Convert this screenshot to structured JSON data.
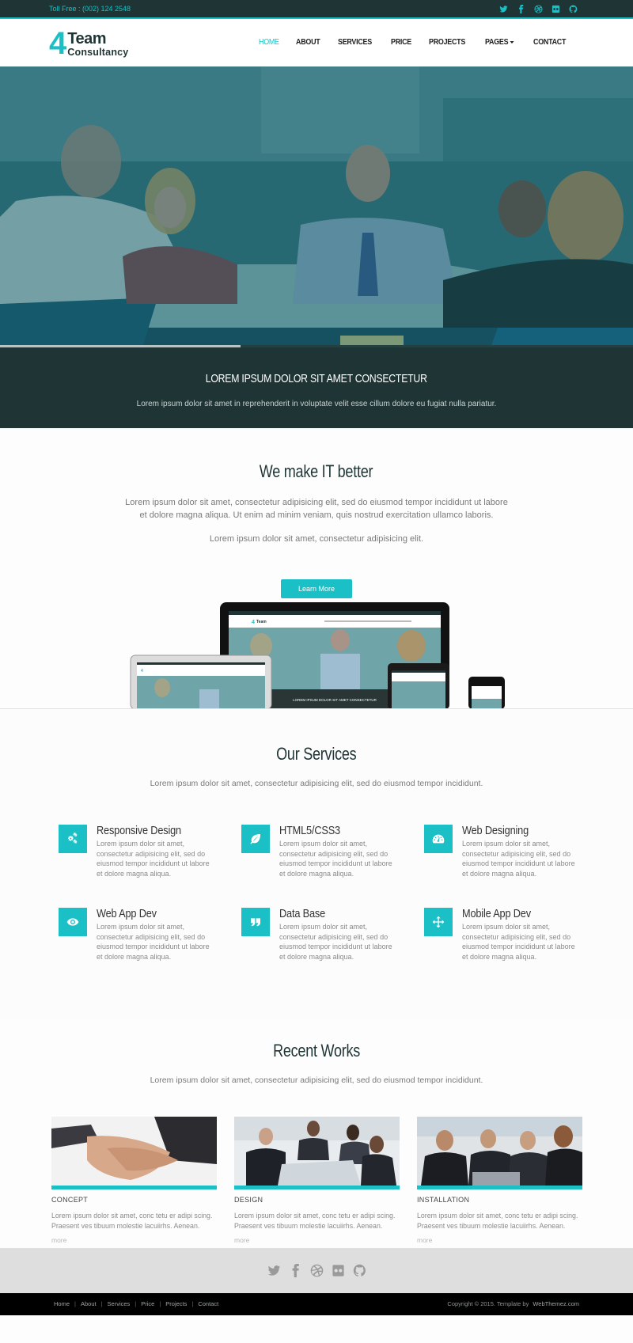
{
  "topbar": {
    "phone": "Toll Free : (002) 124 2548",
    "social": [
      "twitter-icon",
      "facebook-icon",
      "dribbble-icon",
      "flickr-icon",
      "github-icon"
    ]
  },
  "header": {
    "logo": {
      "digit": "4",
      "line1": "Team",
      "line2": "Consultancy"
    },
    "nav": [
      {
        "label": "HOME",
        "active": true
      },
      {
        "label": "ABOUT"
      },
      {
        "label": "SERVICES"
      },
      {
        "label": "PRICE"
      },
      {
        "label": "PROJECTS"
      },
      {
        "label": "PAGES",
        "dropdown": true
      },
      {
        "label": "CONTACT"
      }
    ]
  },
  "hero": {
    "slide_progress": 0.38,
    "title": "LOREM IPSUM DOLOR SIT AMET CONSECTETUR",
    "text": "Lorem ipsum dolor sit amet in reprehenderit in voluptate velit esse cillum dolore eu fugiat nulla pariatur."
  },
  "about": {
    "title": "We make IT better",
    "paragraph1": "Lorem ipsum dolor sit amet, consectetur adipisicing elit, sed do eiusmod tempor incididunt ut labore et dolore magna aliqua. Ut enim ad minim veniam, quis nostrud exercitation ullamco laboris.",
    "paragraph2": "Lorem ipsum dolor sit amet, consectetur adipisicing elit.",
    "button": "Learn More",
    "device_screen_title": "LOREM IPSUM DOLOR SIT AMET CONSECTETUR"
  },
  "services": {
    "title": "Our Services",
    "subtitle": "Lorem ipsum dolor sit amet, consectetur adipisicing elit, sed do eiusmod tempor incididunt.",
    "items": [
      {
        "icon": "gears-icon",
        "title": "Responsive Design",
        "text": "Lorem ipsum dolor sit amet, consectetur adipisicing elit, sed do eiusmod tempor incididunt ut labore et dolore magna aliqua."
      },
      {
        "icon": "leaf-icon",
        "title": "HTML5/CSS3",
        "text": "Lorem ipsum dolor sit amet, consectetur adipisicing elit, sed do eiusmod tempor incididunt ut labore et dolore magna aliqua."
      },
      {
        "icon": "dashboard-icon",
        "title": "Web Designing",
        "text": "Lorem ipsum dolor sit amet, consectetur adipisicing elit, sed do eiusmod tempor incididunt ut labore et dolore magna aliqua."
      },
      {
        "icon": "eye-icon",
        "title": "Web App Dev",
        "text": "Lorem ipsum dolor sit amet, consectetur adipisicing elit, sed do eiusmod tempor incididunt ut labore et dolore magna aliqua."
      },
      {
        "icon": "quote-icon",
        "title": "Data Base",
        "text": "Lorem ipsum dolor sit amet, consectetur adipisicing elit, sed do eiusmod tempor incididunt ut labore et dolore magna aliqua."
      },
      {
        "icon": "move-icon",
        "title": "Mobile App Dev",
        "text": "Lorem ipsum dolor sit amet, consectetur adipisicing elit, sed do eiusmod tempor incididunt ut labore et dolore magna aliqua."
      }
    ]
  },
  "works": {
    "title": "Recent Works",
    "subtitle": "Lorem ipsum dolor sit amet, consectetur adipisicing elit, sed do eiusmod tempor incididunt.",
    "items": [
      {
        "image": "handshake-photo",
        "title": "CONCEPT",
        "text": "Lorem ipsum dolor sit amet, conc tetu er adipi scing. Praesent ves tibuum molestie lacuiirhs. Aenean.",
        "more": "more"
      },
      {
        "image": "meeting-photo",
        "title": "DESIGN",
        "text": "Lorem ipsum dolor sit amet, conc tetu er adipi scing. Praesent ves tibuum molestie lacuiirhs. Aenean.",
        "more": "more"
      },
      {
        "image": "team-laptop-photo",
        "title": "INSTALLATION",
        "text": "Lorem ipsum dolor sit amet, conc tetu er adipi scing. Praesent ves tibuum molestie lacuiirhs. Aenean.",
        "more": "more"
      }
    ]
  },
  "footer": {
    "social": [
      "twitter-icon",
      "facebook-icon",
      "dribbble-icon",
      "flickr-icon",
      "github-icon"
    ],
    "links": [
      "Home",
      "About",
      "Services",
      "Price",
      "Projects",
      "Contact"
    ],
    "copyright": "Copyright © 2015. Template by",
    "credit": "WebThemez.com"
  },
  "colors": {
    "accent": "#1ac0c6",
    "dark": "#1f3434",
    "footer_bg": "#000000",
    "footer_social_bg": "#dedede"
  }
}
